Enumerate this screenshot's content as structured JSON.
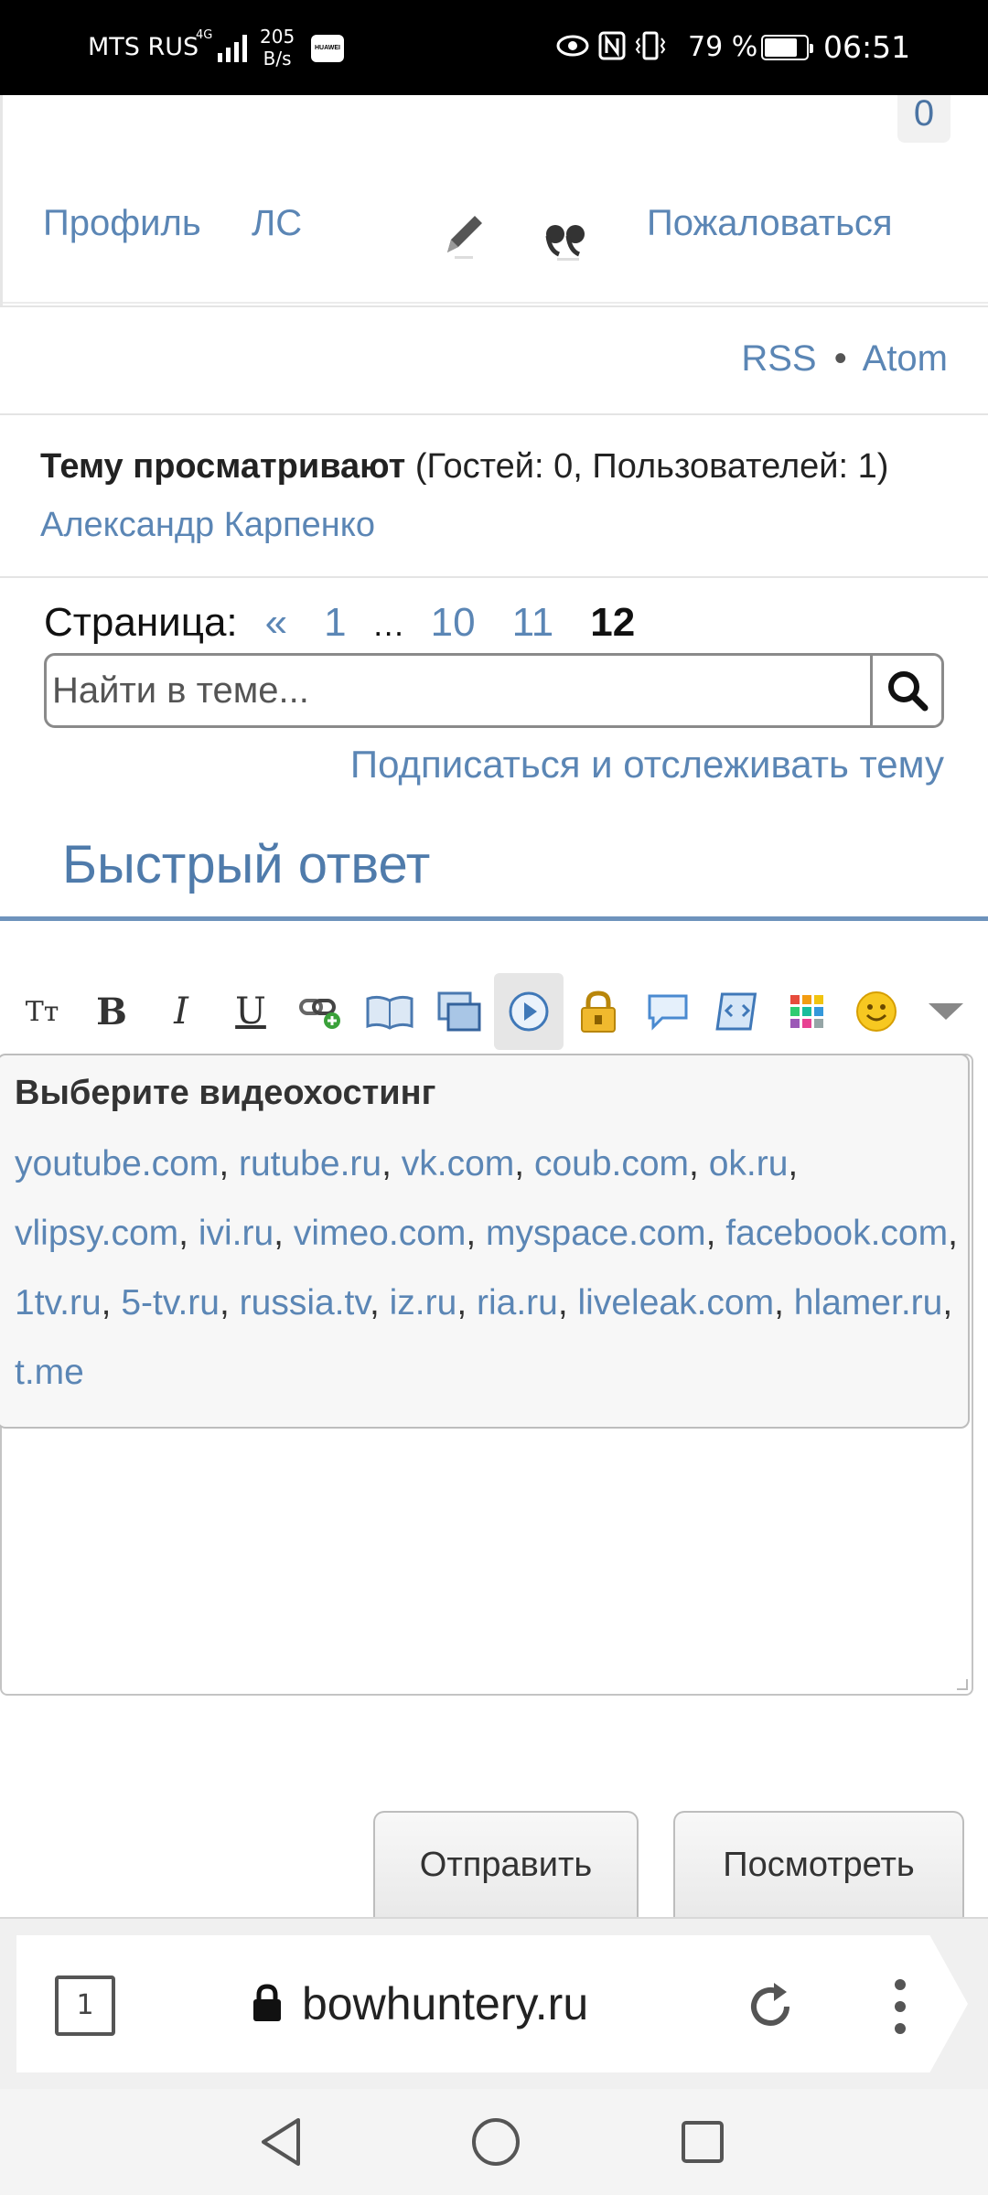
{
  "status_bar": {
    "carrier": "MTS RUS",
    "network": "4G",
    "speed_value": "205",
    "speed_unit": "B/s",
    "huawei_label": "HUAWEI",
    "battery_percent": "79 %",
    "battery_level": 0.79,
    "time": "06:51"
  },
  "post": {
    "rating": "0",
    "profile_link": "Профиль",
    "pm_link": "ЛС",
    "report_link": "Пожаловаться"
  },
  "feeds": {
    "rss": "RSS",
    "separator": "•",
    "atom": "Atom"
  },
  "viewers": {
    "label": "Тему просматривают",
    "counts": " (Гостей: 0, Пользователей: 1) ",
    "user": "Александр Карпенко"
  },
  "pagination": {
    "label": "Страница:",
    "prev": "«",
    "first": "1",
    "ellipsis": "…",
    "p10": "10",
    "p11": "11",
    "current": "12"
  },
  "search": {
    "placeholder": "Найти в теме..."
  },
  "subscribe_link": "Подписаться и отслеживать тему",
  "quick_reply": {
    "title": "Быстрый ответ",
    "toolbar_font_glyph": "Tт",
    "toolbar_bold": "B",
    "toolbar_italic": "I",
    "toolbar_underline": "U"
  },
  "video_popup": {
    "title": "Выберите видеохостинг",
    "hosts": [
      "youtube.com",
      "rutube.ru",
      "vk.com",
      "coub.com",
      "ok.ru",
      "vlipsy.com",
      "ivi.ru",
      "vimeo.com",
      "myspace.com",
      "facebook.com",
      "1tv.ru",
      "5-tv.ru",
      "russia.tv",
      "iz.ru",
      "ria.ru",
      "liveleak.com",
      "hlamer.ru",
      "t.me"
    ]
  },
  "buttons": {
    "send": "Отправить",
    "preview": "Посмотреть"
  },
  "browser": {
    "tab_count": "1",
    "url": "bowhuntery.ru"
  },
  "colors": {
    "link": "#5b86b5",
    "accent_line": "#6e93bc"
  }
}
